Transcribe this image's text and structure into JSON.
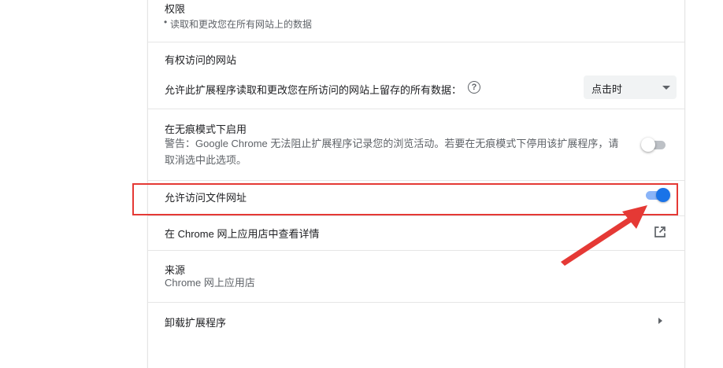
{
  "permissions": {
    "heading": "权限",
    "items": [
      "读取和更改您在所有网站上的数据"
    ]
  },
  "site_access": {
    "heading": "有权访问的网站",
    "label": "允许此扩展程序读取和更改您在所访问的网站上留存的所有数据：",
    "help_glyph": "?",
    "selected_option": "点击时"
  },
  "incognito": {
    "title": "在无痕模式下启用",
    "warning": "警告：Google Chrome 无法阻止扩展程序记录您的浏览活动。若要在无痕模式下停用该扩展程序，请取消选中此选项。",
    "enabled": false
  },
  "file_urls": {
    "title": "允许访问文件网址",
    "enabled": true
  },
  "webstore": {
    "label": "在 Chrome 网上应用店中查看详情"
  },
  "source": {
    "title": "来源",
    "value": "Chrome 网上应用店"
  },
  "uninstall": {
    "label": "卸载扩展程序"
  },
  "colors": {
    "accent": "#1a73e8",
    "highlight_annotation": "#e53935"
  }
}
